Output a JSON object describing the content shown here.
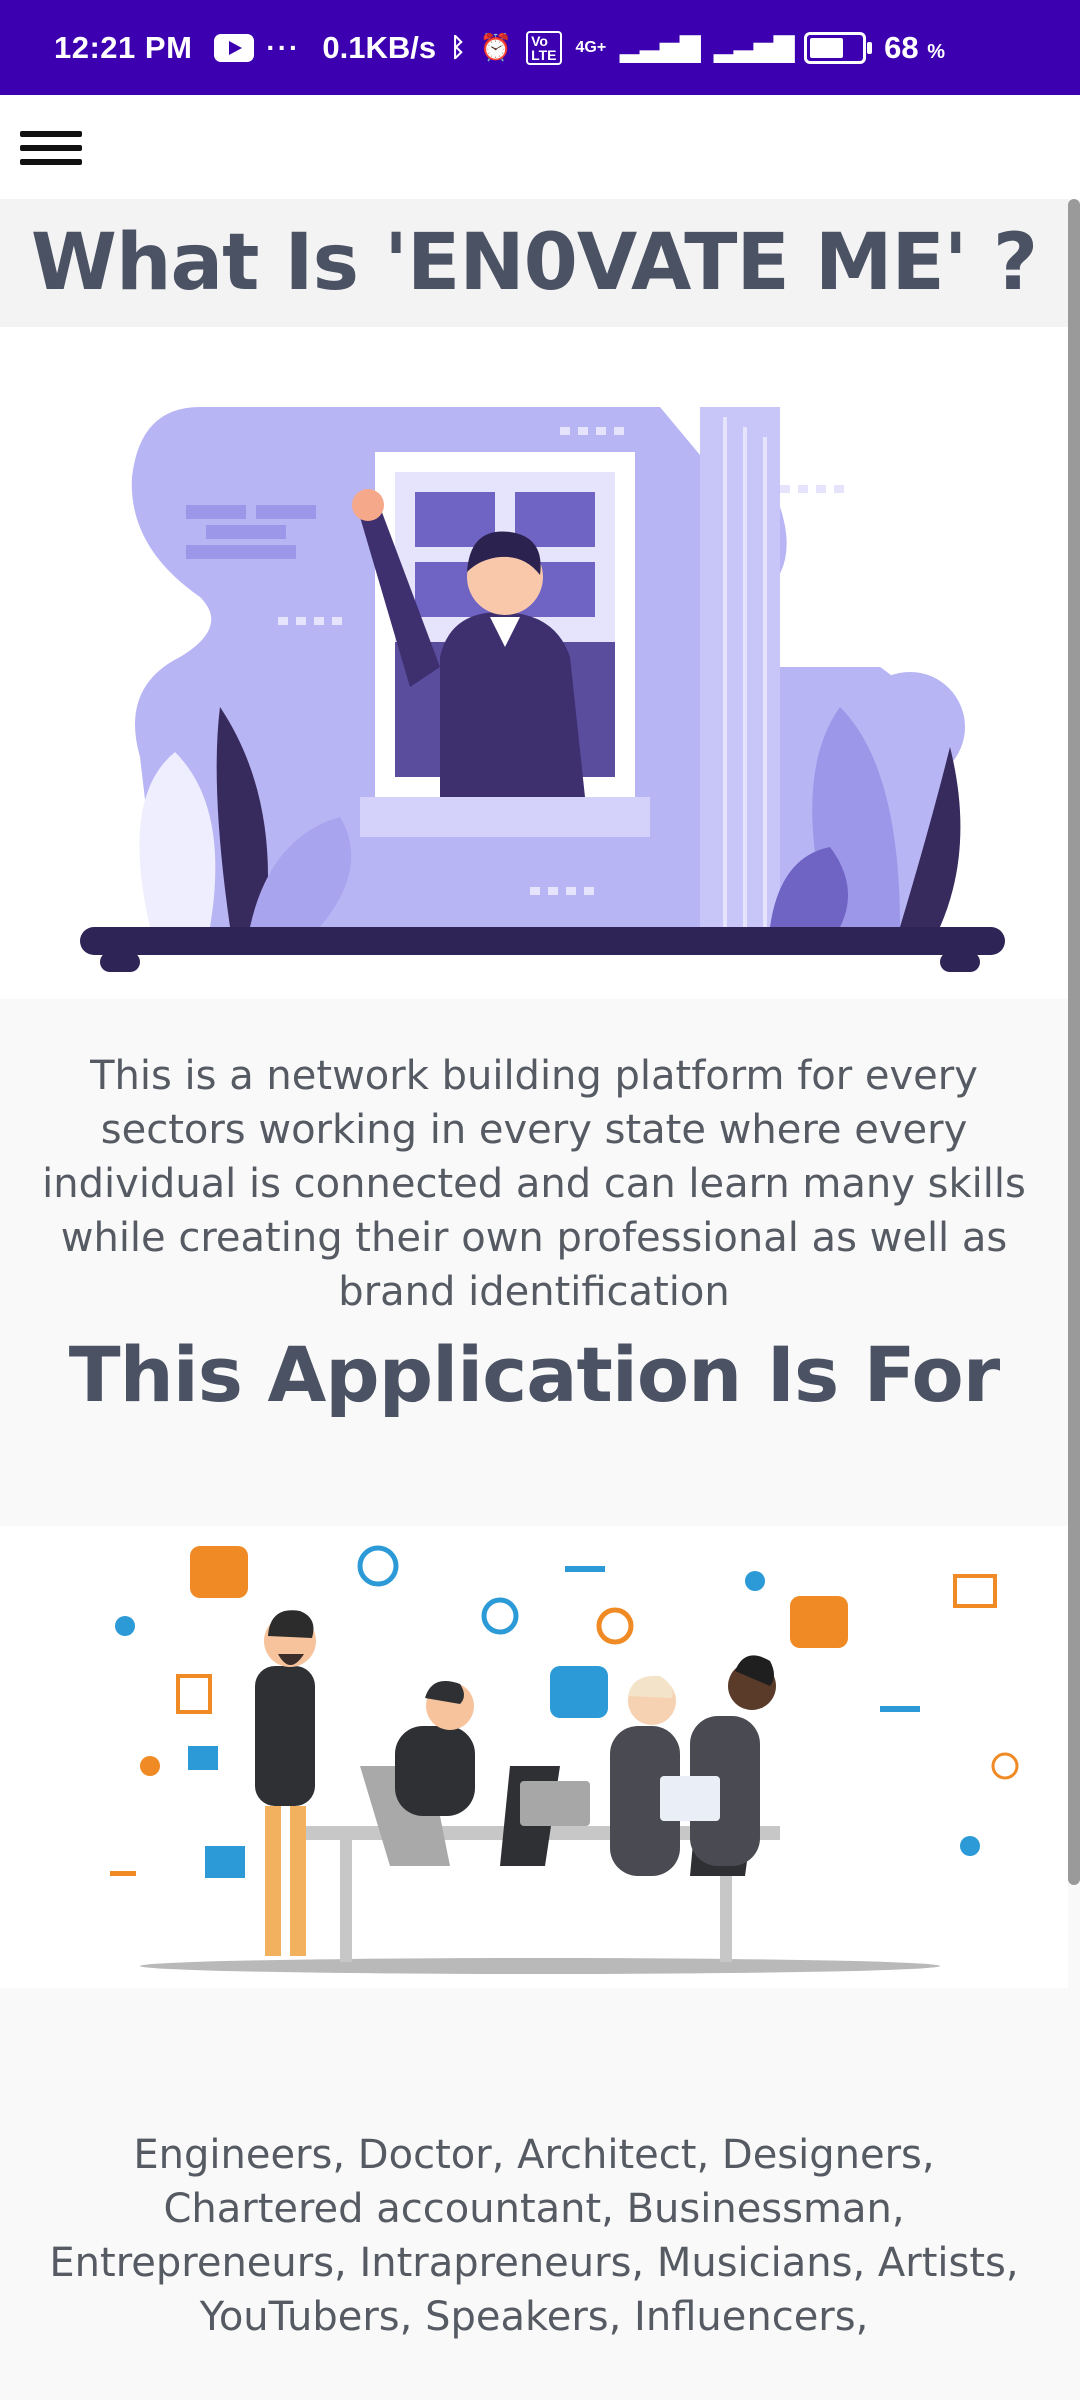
{
  "status_bar": {
    "time": "12:21 PM",
    "dots": "···",
    "speed": "0.1KB/s",
    "network": "4G+",
    "battery_percent": "68",
    "percent_sign": "%",
    "battery_level": 0.68,
    "background_color": "#3d00b0"
  },
  "app_bar": {
    "menu_icon": "hamburger-menu-icon"
  },
  "page": {
    "title": "What Is 'EN0VATE ME' ?",
    "description": "This is a network building platform for every sectors working in every state where every individual is connected and can learn many skills while creating their own professional as well as brand identification",
    "section_title": "This Application Is For",
    "audience_text": "Engineers, Doctor, Architect, Designers, Chartered accountant, Businessman, Entrepreneurs, Intrapreneurs, Musicians, Artists, YouTubers, Speakers, Influencers,"
  },
  "colors": {
    "heading": "#4b5263",
    "body_text": "#555a63",
    "illustration_purple": "#b8b5f5",
    "illustration_dark": "#372a5c",
    "accent_orange": "#f08a24",
    "accent_blue": "#2b9ad6"
  }
}
